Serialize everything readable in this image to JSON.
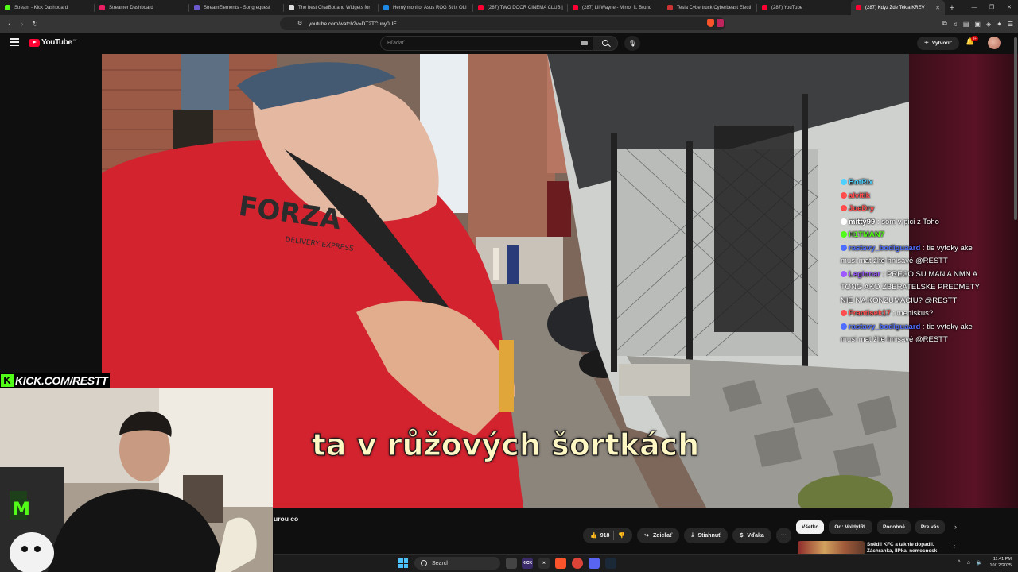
{
  "browser": {
    "tabs": [
      {
        "title": "Stream - Kick Dashboard",
        "color": "#53fc18"
      },
      {
        "title": "Streamer Dashboard",
        "color": "#e91e63"
      },
      {
        "title": "StreamElements - Songrequest",
        "color": "#6a5acd"
      },
      {
        "title": "The best ChatBot and Widgets for",
        "color": "#dddddd"
      },
      {
        "title": "Herný monitor Asus ROG Strix OLI",
        "color": "#1e88e5"
      },
      {
        "title": "(287) TWO DOOR CINEMA CLUB |",
        "color": "#ff0033"
      },
      {
        "title": "(287) Lil Wayne - Mirror ft. Bruno",
        "color": "#ff0033"
      },
      {
        "title": "Tesla Cybertruck Cyberbeast Electi",
        "color": "#cc3333"
      },
      {
        "title": "(287) YouTube",
        "color": "#ff0033"
      },
      {
        "title": "(287) Kdyz Zde Tekla KREV",
        "color": "#ff0033",
        "active": true
      }
    ],
    "url": "youtube.com/watch?v=DT2TCuny0UE",
    "new_tab": "+"
  },
  "youtube": {
    "logo_text": "YouTube",
    "country_code": "SK",
    "search_placeholder": "Hľadať",
    "create_label": "Vytvoriť",
    "notifications_badge": "9+"
  },
  "video": {
    "subtitle": "ta v růžových šortkách"
  },
  "chat": [
    {
      "user": "BotRix",
      "text": "",
      "user_color": "#4fd1ff"
    },
    {
      "user": "alvitik",
      "text": "",
      "user_color": "#ff4d4d"
    },
    {
      "user": "JoeDry",
      "text": "",
      "user_color": "#ff4d4d"
    },
    {
      "user": "mitty99",
      "text": "som v pici z Toho",
      "user_color": "#ffffff"
    },
    {
      "user": "H1TMAN7",
      "text": "",
      "user_color": "#53fc18"
    },
    {
      "user": "rastavy_bodiguaard",
      "text": "tie vytoky ake musi mat žlté hnisavé @RESTT",
      "user_color": "#4f6dff"
    },
    {
      "user": "Legionar",
      "text": "PRECO SU MAN A NMN A TONG AKO ZBERATELSKE PREDMETY NIE NA KONZUMACIU? @RESTT",
      "user_color": "#9b59ff"
    },
    {
      "user": "Frantisek17",
      "text": "meniskus?",
      "user_color": "#ff4d4d"
    },
    {
      "user": "rastavy_bodiguaard",
      "text": "tie vytoky ake musi mat žlté hnisavé @RESTT",
      "user_color": "#4f6dff"
    }
  ],
  "stream_overlay": {
    "kick_logo": "K",
    "kick_url": "KICK.COM/RESTT"
  },
  "watch": {
    "title_fragment": "urou co",
    "likes": "918",
    "share_label": "Zdieľať",
    "download_label": "Stiahnuť",
    "thanks_label": "Vďaka",
    "more_label": "···"
  },
  "related": {
    "chips": [
      "Všetko",
      "Od: VoldyIRL",
      "Podobné",
      "Pre vás"
    ],
    "active_chip": 0,
    "first_video_title": "Snědli KFC a takhle dopadli. Záchranka, IIPka, nemocnosk"
  },
  "taskbar": {
    "search_label": "Search",
    "time": "11:41 PM",
    "date": "10/12/2025"
  }
}
